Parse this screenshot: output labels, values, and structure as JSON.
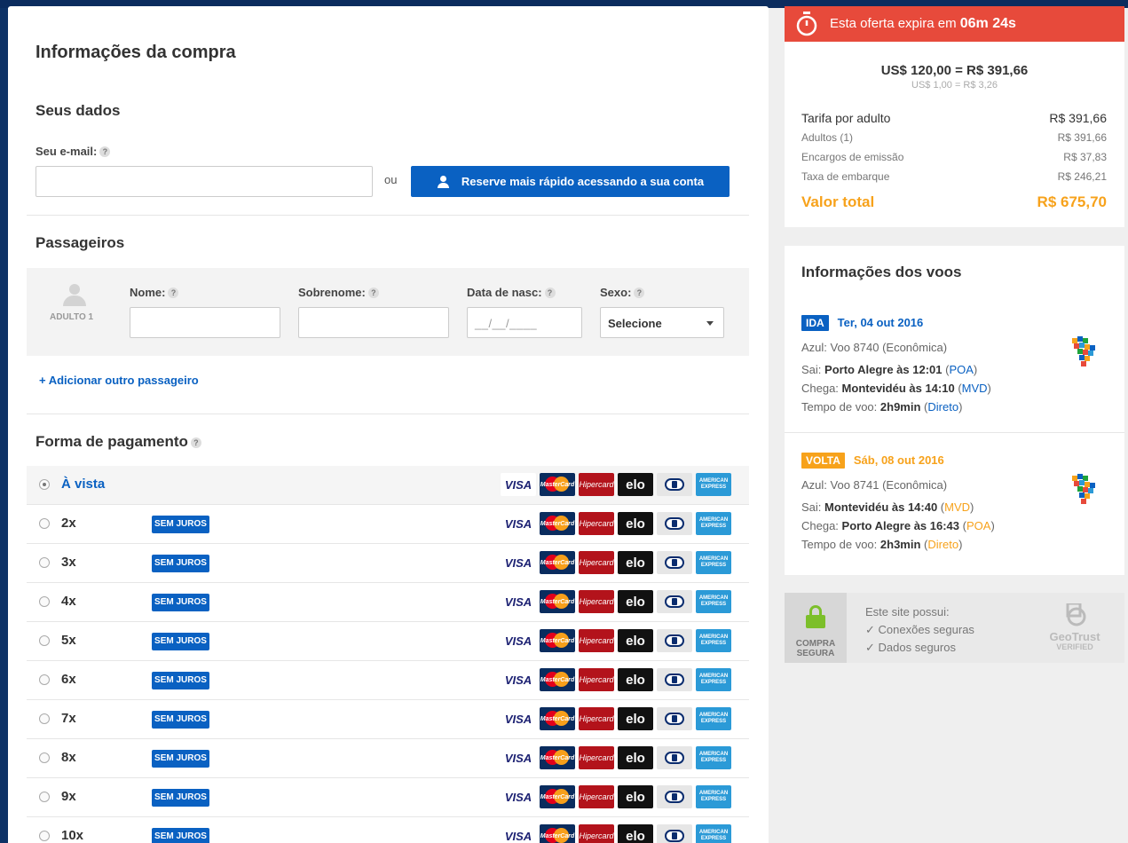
{
  "purchase": {
    "title": "Informações da compra",
    "seus_dados": "Seus dados",
    "email_label": "Seu e-mail:",
    "email_value": "",
    "ou": "ou",
    "login_button": "Reserve mais rápido acessando a sua conta",
    "passageiros": "Passageiros",
    "passenger_label": "ADULTO 1",
    "nome_label": "Nome:",
    "sobrenome_label": "Sobrenome:",
    "nasc_label": "Data de nasc:",
    "nasc_placeholder": "__/__/____",
    "sexo_label": "Sexo:",
    "sexo_value": "Selecione",
    "add_passenger": "+ Adicionar outro passageiro",
    "forma_pagamento": "Forma de pagamento",
    "help": "?"
  },
  "payment": {
    "badge": "SEM JUROS",
    "cards": [
      "VISA",
      "MasterCard",
      "Hipercard",
      "elo",
      "Diners",
      "AMERICAN EXPRESS"
    ],
    "options": [
      {
        "label": "À vista",
        "selected": true,
        "badge": false
      },
      {
        "label": "2x",
        "selected": false,
        "badge": true
      },
      {
        "label": "3x",
        "selected": false,
        "badge": true
      },
      {
        "label": "4x",
        "selected": false,
        "badge": true
      },
      {
        "label": "5x",
        "selected": false,
        "badge": true
      },
      {
        "label": "6x",
        "selected": false,
        "badge": true
      },
      {
        "label": "7x",
        "selected": false,
        "badge": true
      },
      {
        "label": "8x",
        "selected": false,
        "badge": true
      },
      {
        "label": "9x",
        "selected": false,
        "badge": true
      },
      {
        "label": "10x",
        "selected": false,
        "badge": true
      }
    ]
  },
  "offer": {
    "text": "Esta oferta expira em",
    "time": "06m 24s"
  },
  "fare": {
    "conversion": "US$ 120,00 = R$ 391,66",
    "rate": "US$ 1,00 = R$ 3,26",
    "rows": [
      {
        "label": "Tarifa por adulto",
        "value": "R$ 391,66"
      },
      {
        "label": "Adultos (1)",
        "value": "R$ 391,66"
      },
      {
        "label": "Encargos de emissão",
        "value": "R$ 37,83"
      },
      {
        "label": "Taxa de embarque",
        "value": "R$ 246,21"
      }
    ],
    "total_label": "Valor total",
    "total_value": "R$ 675,70"
  },
  "flights": {
    "title": "Informações dos voos",
    "legs": [
      {
        "tag": "IDA",
        "date": "Ter, 04 out 2016",
        "flight": "Azul: Voo 8740 (Econômica)",
        "sai_label": "Sai:",
        "sai_city": "Porto Alegre às 12:01",
        "sai_code": "POA",
        "chega_label": "Chega:",
        "chega_city": "Montevidéu às 14:10",
        "chega_code": "MVD",
        "tempo_label": "Tempo de voo:",
        "tempo": "2h9min",
        "tipo": "Direto"
      },
      {
        "tag": "VOLTA",
        "date": "Sáb, 08 out 2016",
        "flight": "Azul: Voo 8741 (Econômica)",
        "sai_label": "Sai:",
        "sai_city": "Montevidéu às 14:40",
        "sai_code": "MVD",
        "chega_label": "Chega:",
        "chega_city": "Porto Alegre às 16:43",
        "chega_code": "POA",
        "tempo_label": "Tempo de voo:",
        "tempo": "2h3min",
        "tipo": "Direto"
      }
    ]
  },
  "security": {
    "compra": "COMPRA",
    "segura": "SEGURA",
    "possui": "Este site possui:",
    "item1": "Conexões seguras",
    "item2": "Dados seguros",
    "geotrust": "GeoTrust",
    "verified": "VERIFIED"
  },
  "colors": {
    "primary": "#0a61c2",
    "accent": "#f7a21b",
    "alert": "#e74a3b",
    "secure": "#7cbf2a"
  }
}
